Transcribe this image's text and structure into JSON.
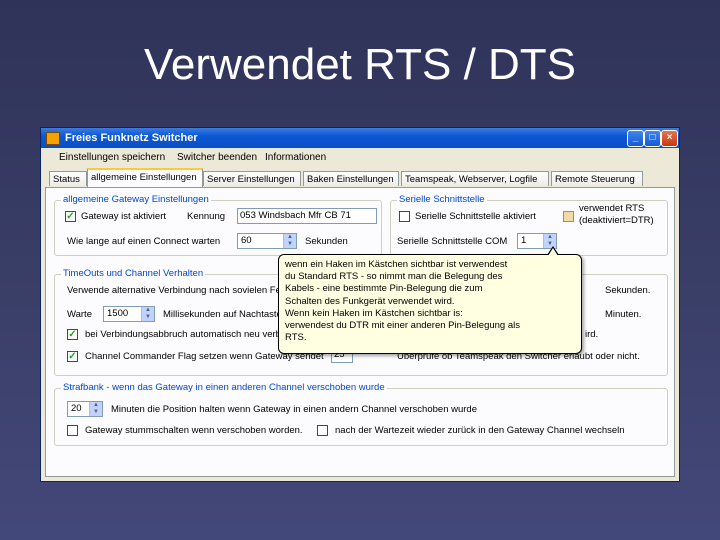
{
  "slide": {
    "title": "Verwendet RTS / DTS"
  },
  "window": {
    "title": "Freies Funknetz Switcher",
    "buttons": {
      "minimize": "_",
      "maximize": "□",
      "close": "×"
    },
    "menu": [
      "Einstellungen speichern",
      "Switcher beenden",
      "Informationen"
    ],
    "tabs": [
      "Status",
      "allgemeine Einstellungen",
      "Server Einstellungen",
      "Baken Einstellungen",
      "Teamspeak, Webserver, Logfile",
      "Remote Steuerung"
    ],
    "active_tab": "allgemeine Einstellungen"
  },
  "gateway_group": {
    "title": "allgemeine Gateway Einstellungen",
    "active_label": "Gateway ist aktiviert",
    "active_checked": true,
    "kennung_label": "Kennung",
    "kennung_value": "053 Windsbach Mfr CB 71",
    "connect_label": "Wie lange auf einen Connect warten",
    "connect_value": "60",
    "connect_unit": "Sekunden"
  },
  "serial_group": {
    "title": "Serielle Schnittstelle",
    "active_label": "Serielle Schnittstelle aktiviert",
    "com_label": "Serielle Schnittstelle COM",
    "com_value": "1",
    "rts_label": "verwendet RTS",
    "rts_sub": "(deaktiviert=DTR)"
  },
  "timeouts_group": {
    "title": "TimeOuts und Channel Verhalten",
    "fail_label": "Verwende alternative Verbindung nach sovielen Fehlern:",
    "sec_unit": "Sekunden.",
    "wait_label": "Warte",
    "wait_value": "1500",
    "wait_unit": "Millisekunden auf Nachtasten.",
    "min_unit": "Minuten.",
    "reconnect_label": "bei Verbindungsabbruch automatisch neu verbinden.",
    "reconnect_checked": true,
    "ward_fragment": "ird.",
    "commander_label": "Channel Commander Flag setzen wenn Gateway sendet",
    "commander_checked": true,
    "commander_value": "25",
    "check_label": "Uberprüfe ob Teamspeak den Switcher erlaubt oder nicht."
  },
  "penalty_group": {
    "title": "Strafbank - wenn das Gateway in einen anderen Channel verschoben wurde",
    "minutes_value": "20",
    "minutes_label": "Minuten die Position halten wenn Gateway in einen andern Channel verschoben wurde",
    "mute_label": "Gateway stummschalten wenn verschoben worden.",
    "return_label": "nach der Wartezeit wieder zurück in den Gateway Channel wechseln"
  },
  "tooltip": {
    "lines": [
      "wenn ein Haken im Kästchen sichtbar ist verwendest",
      "du Standard RTS - so nimmt man die Belegung des",
      "Kabels - eine bestimmte Pin-Belegung die zum",
      "Schalten des Funkgerät verwendet wird.",
      "Wenn kein Haken im Kästchen sichtbar is:",
      "verwendest du DTR mit einer anderen Pin-Belegung als",
      "RTS."
    ]
  },
  "colors": {
    "background": "#3a3f68",
    "titlebar": "#0a58d5",
    "group_title": "#0046d5",
    "tooltip_bg": "#ffffe1",
    "active_tab_accent": "#ffc83c"
  }
}
